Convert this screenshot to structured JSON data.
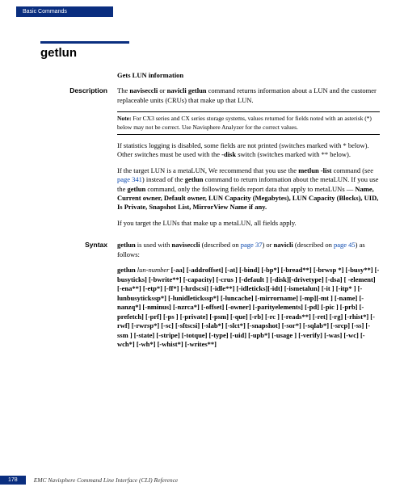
{
  "header": {
    "tab": "Basic Commands"
  },
  "title": "getlun",
  "subtitle": "Gets LUN information",
  "sections": {
    "description": {
      "label": "Description",
      "p1_pre": "The ",
      "p1_cmd": "naviseccli",
      "p1_mid": " or ",
      "p1_cmd2": "navicli getlun",
      "p1_post": " command returns information about a LUN and the customer replaceable units (CRUs) that make up that LUN.",
      "note_label": "Note:",
      "note_text": " For CX3 series and CX series storage systems, values returned for fields noted with an asterisk (*) below may not be correct. Use Navisphere Analyzer for the correct values.",
      "p2_pre": "If statistics logging is disabled, some fields are not printed (switches marked with * below). Other switches must be used with the ",
      "p2_cmd": "-disk",
      "p2_post": " switch (switches marked with ** below).",
      "p3_pre": "If the target LUN is a metaLUN, We recommend that you use the ",
      "p3_cmd": "metlun -list",
      "p3_mid": " command (see ",
      "p3_link": "page 341",
      "p3_mid2": ") instead of the ",
      "p3_cmd2": "getlun",
      "p3_mid3": " command to return information about the metaLUN. If you use the ",
      "p3_cmd3": "getlun",
      "p3_mid4": " command, only the following fields report data that apply to metaLUNs — ",
      "p3_fields": "Name, Current owner, Default owner, LUN Capacity (Megabytes), LUN Capacity (Blocks), UID, Is Private, Snapshot List, MirrorView Name if any.",
      "p4": "If you target the LUNs that make up a metaLUN, all fields apply."
    },
    "syntax": {
      "label": "Syntax",
      "intro_cmd": "getlun",
      "intro_mid": " is used with ",
      "intro_cmd2": "naviseccli",
      "intro_mid2": " (described on ",
      "intro_link": "page 37",
      "intro_mid3": ") or ",
      "intro_cmd3": "navicli",
      "intro_mid4": " (described on ",
      "intro_link2": "page 45",
      "intro_post": ") as follows:",
      "cmd": "getlun",
      "arg": "lun-number",
      "switches": " [-aa] [-addroffset]  [-at] [-bind] [-bp*] [-bread**] [-brwsp *] [-busy**] [-busyticks] [-bwrite**] [-capacity] [-crus ] [-default ] [-disk][-drivetype] [-dsa] [ -element] [-ena**] [-etp*] [-ff*] [-hrdscsi] [-idle**] [-idleticks][-idt] [-ismetalun] [-it ] [-itp* ] [-lunbusytickssp*] [-lunidletickssp*] [-luncache] [-mirrorname] [-mp][-mt ] [-name] [-nanzq*] [-nminus] [-nzrca*] [-offset] [-owner] [-parityelements] [-pd] [-pic ] [-prb] [-prefetch] [-prf] [-ps ] [-private] [-psm] [-que] [-rb] [-rc ] [-reads**] [-ret] [-rg] [-rhist*] [-rwf] [-rwrsp*] [-sc] [-sftscsi] [-slab*] [-slct*] [-snapshot] [-sor*] [-sqlab*] [-srcp] [-ss] [-ssm ] [-state] [-stripe] [-totque] [-type] [-uid] [-upb*] [-usage ] [-verify] [-was] [-wc] [-wch*] [-wh*] [-whist*] [-writes**]"
    }
  },
  "footer": {
    "page": "178",
    "text": "EMC Navisphere Command Line Interface (CLI) Reference"
  }
}
